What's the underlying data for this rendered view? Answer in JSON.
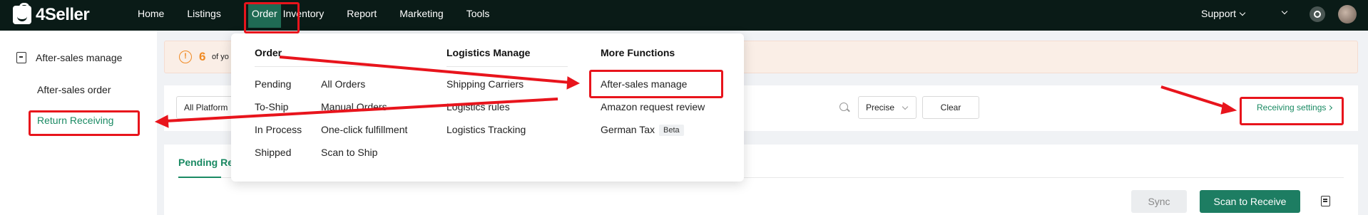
{
  "topbar": {
    "logo": "4Seller",
    "nav": [
      "Home",
      "Listings",
      "Order",
      "Inventory",
      "Report",
      "Marketing",
      "Tools"
    ],
    "support": "Support"
  },
  "sidebar": {
    "title": "After-sales manage",
    "items": [
      "After-sales order",
      "Return Receiving"
    ]
  },
  "alert": {
    "count": "6",
    "text": "of yo"
  },
  "filters": {
    "platform": "All Platform",
    "match": "Precise",
    "clear": "Clear",
    "receiving_settings": "Receiving settings"
  },
  "panel": {
    "tab": "Pending Re",
    "sync": "Sync",
    "scan": "Scan to Receive"
  },
  "dropdown": {
    "order": {
      "heading": "Order",
      "col1": [
        "Pending",
        "To-Ship",
        "In Process",
        "Shipped"
      ],
      "col2": [
        "All Orders",
        "Manual Orders",
        "One-click fulfillment",
        "Scan to Ship"
      ]
    },
    "logistics": {
      "heading": "Logistics Manage",
      "items": [
        "Shipping Carriers",
        "Logistics rules",
        "Logistics Tracking"
      ]
    },
    "more": {
      "heading": "More Functions",
      "items": [
        "After-sales manage",
        "Amazon request review",
        "German Tax"
      ],
      "badge": "Beta"
    }
  },
  "colors": {
    "accent": "#1d7d62",
    "annotation": "#e8141c",
    "topbar": "#0a1b17"
  }
}
